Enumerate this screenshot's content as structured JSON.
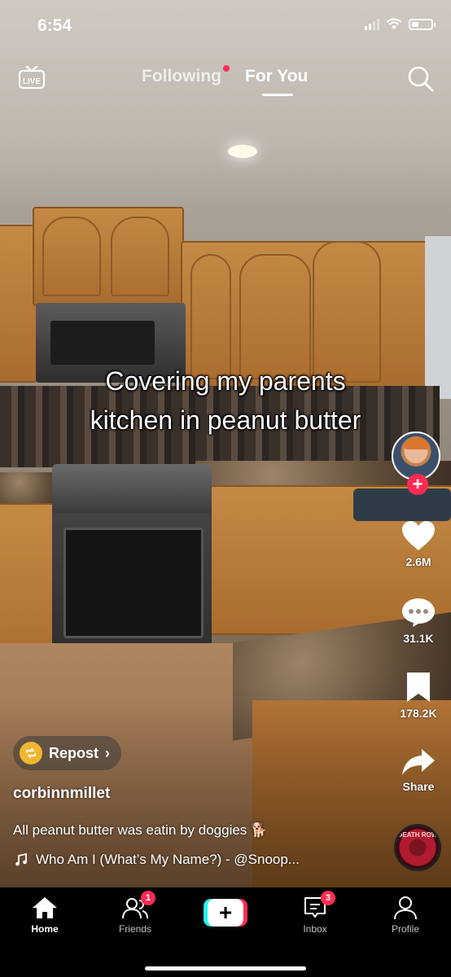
{
  "status_bar": {
    "time": "6:54"
  },
  "top_nav": {
    "live_label": "LIVE",
    "tabs": [
      {
        "label": "Following",
        "has_dot": true,
        "active": false
      },
      {
        "label": "For You",
        "active": true
      }
    ]
  },
  "video": {
    "caption_line1": "Covering my parents",
    "caption_line2": "kitchen in peanut butter"
  },
  "rail": {
    "likes": "2.6M",
    "comments": "31.1K",
    "saves": "178.2K",
    "share_label": "Share",
    "disc_text": "DEATH ROW"
  },
  "post": {
    "repost_label": "Repost",
    "username": "corbinnmillet",
    "description": "All peanut butter was eatin by doggies",
    "description_emoji": "🐕",
    "music": "Who Am I (What’s My Name?) - @Snoop..."
  },
  "bottom_nav": {
    "items": [
      {
        "label": "Home",
        "active": true
      },
      {
        "label": "Friends",
        "badge": "1"
      },
      {
        "label": "Inbox",
        "badge": "3"
      },
      {
        "label": "Profile"
      }
    ]
  },
  "colors": {
    "accent": "#fe2c55",
    "cyan": "#25f4ee",
    "repost": "#f0b72f"
  }
}
